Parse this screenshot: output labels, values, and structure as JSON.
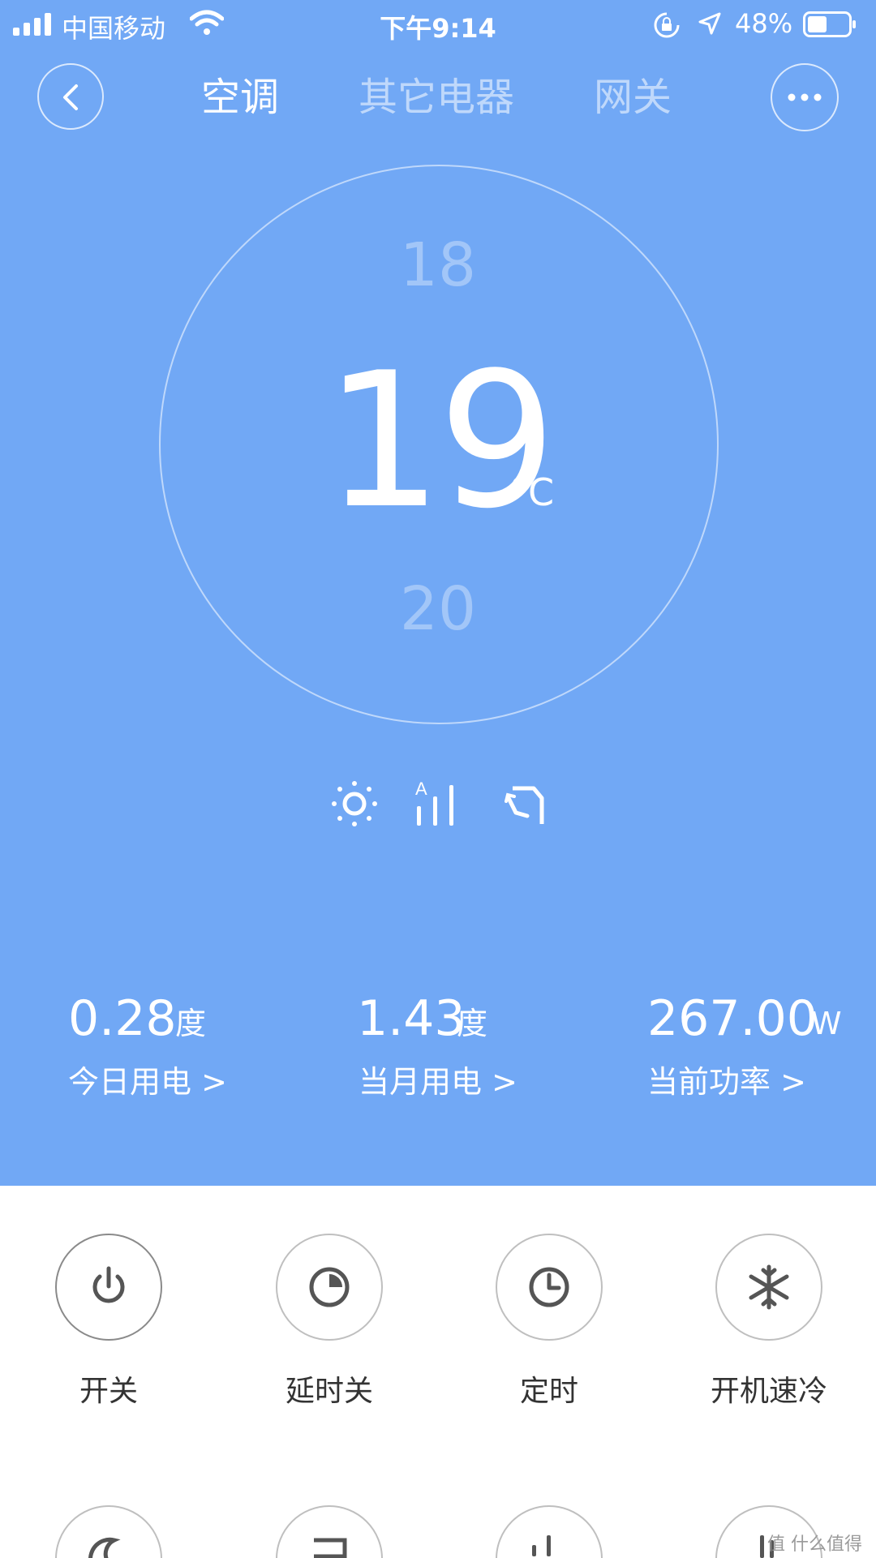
{
  "status_bar": {
    "carrier": "中国移动",
    "time": "下午9:14",
    "battery": "48%",
    "battery_level": 0.48
  },
  "nav": {
    "tabs": [
      {
        "label": "空调",
        "active": true
      },
      {
        "label": "其它电器",
        "active": false
      },
      {
        "label": "网关",
        "active": false
      }
    ],
    "back_icon": "chevron-left-icon",
    "more_icon": "more-horizontal-icon"
  },
  "thermostat": {
    "previous": "18",
    "current": "19",
    "unit": "°C",
    "next": "20"
  },
  "modes": [
    {
      "icon": "sun-icon",
      "name": "heat"
    },
    {
      "icon": "auto-fan-speed-icon",
      "name": "fan-auto"
    },
    {
      "icon": "swing-icon",
      "name": "swing"
    }
  ],
  "stats": [
    {
      "value": "0.28",
      "unit": "度",
      "label": "今日用电 >"
    },
    {
      "value": "1.43",
      "unit": "度",
      "label": "当月用电 >"
    },
    {
      "value": "267.00",
      "unit": "W",
      "label": "当前功率 >"
    }
  ],
  "controls": [
    {
      "label": "开关",
      "icon": "power-icon"
    },
    {
      "label": "延时关",
      "icon": "delay-off-icon"
    },
    {
      "label": "定时",
      "icon": "clock-icon"
    },
    {
      "label": "开机速冷",
      "icon": "snowflake-icon"
    }
  ],
  "watermark": "值 什么值得买",
  "colors": {
    "header_bg": "#71a8f5",
    "text_white": "#ffffff",
    "button_border": "#bfbfbf",
    "label_text": "#333333"
  }
}
